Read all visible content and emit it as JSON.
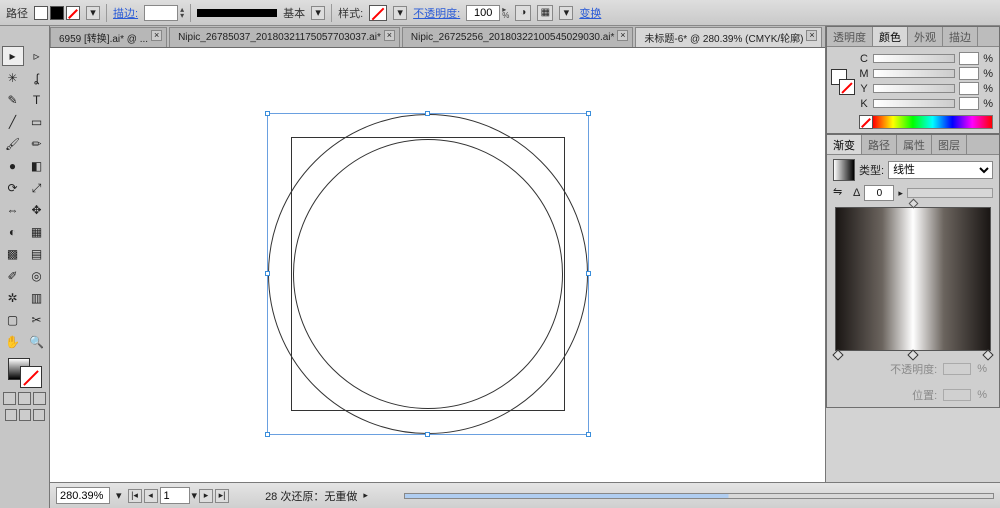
{
  "optionbar": {
    "path_label": "路径",
    "stroke_label": "描边:",
    "basic_label": "基本",
    "style_label": "样式:",
    "opacity_link": "不透明度:",
    "opacity_value": "100",
    "transform_link": "变换"
  },
  "doc_tabs": [
    {
      "label": "6959 [转换].ai* @ ..."
    },
    {
      "label": "Nipic_26785037_20180321175057703037.ai*"
    },
    {
      "label": "Nipic_26725256_20180322100545029030.ai*"
    },
    {
      "label": "未标题-6* @ 280.39% (CMYK/轮廓)",
      "active": true
    }
  ],
  "tools": [
    {
      "n": "selection-tool",
      "g": "▸",
      "sel": true
    },
    {
      "n": "direct-select-tool",
      "g": "▹"
    },
    {
      "n": "magic-wand-tool",
      "g": "✳"
    },
    {
      "n": "lasso-tool",
      "g": "ʆ"
    },
    {
      "n": "pen-tool",
      "g": "✎"
    },
    {
      "n": "type-tool",
      "g": "T"
    },
    {
      "n": "line-tool",
      "g": "╱"
    },
    {
      "n": "rectangle-tool",
      "g": "▭"
    },
    {
      "n": "paintbrush-tool",
      "g": "🖌"
    },
    {
      "n": "pencil-tool",
      "g": "✏"
    },
    {
      "n": "blob-brush-tool",
      "g": "●"
    },
    {
      "n": "eraser-tool",
      "g": "◧"
    },
    {
      "n": "rotate-tool",
      "g": "⟳"
    },
    {
      "n": "scale-tool",
      "g": "⤢"
    },
    {
      "n": "width-tool",
      "g": "⇔"
    },
    {
      "n": "free-transform-tool",
      "g": "✥"
    },
    {
      "n": "shape-builder-tool",
      "g": "◐"
    },
    {
      "n": "perspective-tool",
      "g": "▦"
    },
    {
      "n": "mesh-tool",
      "g": "▩"
    },
    {
      "n": "gradient-tool",
      "g": "▤"
    },
    {
      "n": "eyedropper-tool",
      "g": "✐"
    },
    {
      "n": "blend-tool",
      "g": "◎"
    },
    {
      "n": "symbol-sprayer-tool",
      "g": "✲"
    },
    {
      "n": "column-graph-tool",
      "g": "▥"
    },
    {
      "n": "artboard-tool",
      "g": "▢"
    },
    {
      "n": "slice-tool",
      "g": "✂"
    },
    {
      "n": "hand-tool",
      "g": "✋"
    },
    {
      "n": "zoom-tool",
      "g": "🔍"
    }
  ],
  "panels": {
    "color": {
      "tabs": [
        "透明度",
        "颜色",
        "外观",
        "描边"
      ],
      "active": 1,
      "channels": [
        {
          "l": "C",
          "v": ""
        },
        {
          "l": "M",
          "v": ""
        },
        {
          "l": "Y",
          "v": ""
        },
        {
          "l": "K",
          "v": ""
        }
      ],
      "pct": "%"
    },
    "gradient": {
      "tabs": [
        "渐变",
        "路径",
        "属性",
        "图层"
      ],
      "active": 0,
      "type_label": "类型:",
      "type_value": "线性",
      "angle_label": "Δ",
      "angle_value": "0",
      "opacity_label": "不透明度:",
      "location_label": "位置:"
    }
  },
  "status": {
    "zoom": "280.39%",
    "page": "1",
    "undo_label": "28 次还原：无重做"
  }
}
